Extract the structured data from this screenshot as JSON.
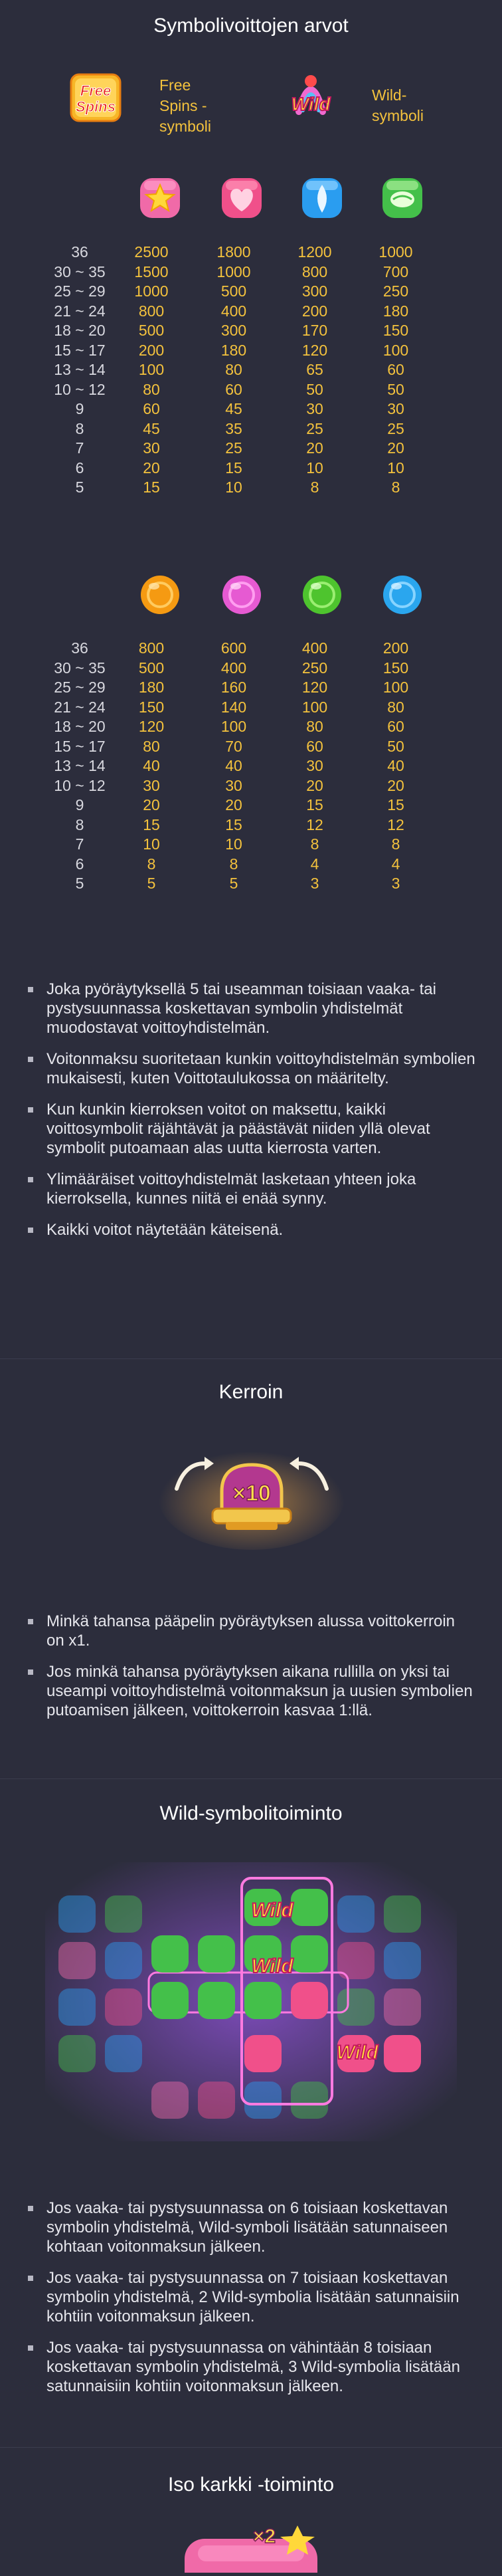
{
  "sections": {
    "values_title": "Symbolivoittojen arvot",
    "multiplier_title": "Kerroin",
    "wild_title": "Wild-symbolitoiminto",
    "big_candy_title": "Iso karkki -toiminto"
  },
  "specials": {
    "free_spins_logo_line1": "Free",
    "free_spins_logo_line2": "Spins",
    "free_spins_label": "Free\nSpins -\nsymboli",
    "free_spins_label_lines": [
      "Free",
      "Spins -",
      "symboli"
    ],
    "wild_logo": "Wild",
    "wild_label_lines": [
      "Wild-",
      "symboli"
    ]
  },
  "table1": {
    "symbols": [
      "yellow-star-candy",
      "pink-heart-candy",
      "blue-wrapped-candy",
      "green-swirl-candy"
    ],
    "colors": [
      "#f06aa8",
      "#f0508a",
      "#2a9df0",
      "#44c04a"
    ],
    "rows": [
      {
        "count": "36",
        "vals": [
          "2500",
          "1800",
          "1200",
          "1000"
        ]
      },
      {
        "count": "30 ~ 35",
        "vals": [
          "1500",
          "1000",
          "800",
          "700"
        ]
      },
      {
        "count": "25 ~ 29",
        "vals": [
          "1000",
          "500",
          "300",
          "250"
        ]
      },
      {
        "count": "21 ~ 24",
        "vals": [
          "800",
          "400",
          "200",
          "180"
        ]
      },
      {
        "count": "18 ~ 20",
        "vals": [
          "500",
          "300",
          "170",
          "150"
        ]
      },
      {
        "count": "15 ~ 17",
        "vals": [
          "200",
          "180",
          "120",
          "100"
        ]
      },
      {
        "count": "13 ~ 14",
        "vals": [
          "100",
          "80",
          "65",
          "60"
        ]
      },
      {
        "count": "10 ~ 12",
        "vals": [
          "80",
          "60",
          "50",
          "50"
        ]
      },
      {
        "count": "9",
        "vals": [
          "60",
          "45",
          "30",
          "30"
        ]
      },
      {
        "count": "8",
        "vals": [
          "45",
          "35",
          "25",
          "25"
        ]
      },
      {
        "count": "7",
        "vals": [
          "30",
          "25",
          "20",
          "20"
        ]
      },
      {
        "count": "6",
        "vals": [
          "20",
          "15",
          "10",
          "10"
        ]
      },
      {
        "count": "5",
        "vals": [
          "15",
          "10",
          "8",
          "8"
        ]
      }
    ]
  },
  "table2": {
    "symbols": [
      "orange-ball-candy",
      "pink-ball-candy",
      "green-ball-candy",
      "blue-ball-candy"
    ],
    "colors": [
      "#f59a12",
      "#e65ad2",
      "#4ec42e",
      "#2aa6ee"
    ],
    "rows": [
      {
        "count": "36",
        "vals": [
          "800",
          "600",
          "400",
          "200"
        ]
      },
      {
        "count": "30 ~ 35",
        "vals": [
          "500",
          "400",
          "250",
          "150"
        ]
      },
      {
        "count": "25 ~ 29",
        "vals": [
          "180",
          "160",
          "120",
          "100"
        ]
      },
      {
        "count": "21 ~ 24",
        "vals": [
          "150",
          "140",
          "100",
          "80"
        ]
      },
      {
        "count": "18 ~ 20",
        "vals": [
          "120",
          "100",
          "80",
          "60"
        ]
      },
      {
        "count": "15 ~ 17",
        "vals": [
          "80",
          "70",
          "60",
          "50"
        ]
      },
      {
        "count": "13 ~ 14",
        "vals": [
          "40",
          "40",
          "30",
          "40"
        ]
      },
      {
        "count": "10 ~ 12",
        "vals": [
          "30",
          "30",
          "20",
          "20"
        ]
      },
      {
        "count": "9",
        "vals": [
          "20",
          "20",
          "15",
          "15"
        ]
      },
      {
        "count": "8",
        "vals": [
          "15",
          "15",
          "12",
          "12"
        ]
      },
      {
        "count": "7",
        "vals": [
          "10",
          "10",
          "8",
          "8"
        ]
      },
      {
        "count": "6",
        "vals": [
          "8",
          "8",
          "4",
          "4"
        ]
      },
      {
        "count": "5",
        "vals": [
          "5",
          "5",
          "3",
          "3"
        ]
      }
    ]
  },
  "rules_values": [
    "Joka pyöräytyksellä 5 tai useamman toisiaan vaaka- tai pystysuunnassa koskettavan symbolin yhdistelmät muodostavat voittoyhdistelmän.",
    "Voitonmaksu suoritetaan kunkin voittoyhdistelmän symbolien mukaisesti, kuten Voittotaulukossa on määritelty.",
    "Kun kunkin kierroksen voitot on maksettu, kaikki voittosymbolit räjähtävät ja päästävät niiden yllä olevat symbolit putoamaan alas uutta kierrosta varten.",
    "Ylimääräiset voittoyhdistelmät lasketaan yhteen joka kierroksella, kunnes niitä ei enää synny.",
    "Kaikki voitot näytetään käteisenä."
  ],
  "multiplier": {
    "badge": "×10",
    "rules": [
      "Minkä tahansa pääpelin pyöräytyksen alussa voittokerroin on x1.",
      "Jos minkä tahansa pyöräytyksen aikana rullilla on yksi tai useampi voittoyhdistelmä voitonmaksun ja uusien symbolien putoamisen jälkeen, voittokerroin kasvaa 1:llä."
    ]
  },
  "wild": {
    "logo": "Wild",
    "rules": [
      "Jos vaaka- tai pystysuunnassa on 6 toisiaan koskettavan symbolin yhdistelmä, Wild-symboli lisätään satunnaiseen kohtaan voitonmaksun jälkeen.",
      "Jos vaaka- tai pystysuunnassa on 7 toisiaan koskettavan symbolin yhdistelmä, 2 Wild-symbolia lisätään satunnaisiin kohtiin voitonmaksun jälkeen.",
      "Jos vaaka- tai pystysuunnassa on vähintään 8 toisiaan koskettavan symbolin yhdistelmä, 3 Wild-symbolia lisätään satunnaisiin kohtiin voitonmaksun jälkeen."
    ]
  },
  "big_candy": {
    "badge": "×2"
  }
}
